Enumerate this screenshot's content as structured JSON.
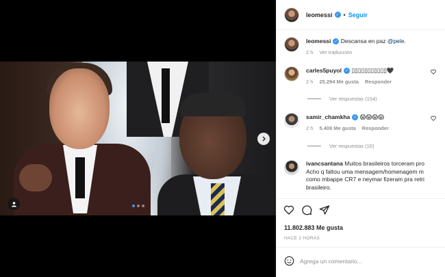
{
  "header": {
    "username": "leomessi",
    "separator": "•",
    "follow_label": "Seguir"
  },
  "caption": {
    "username": "leomessi",
    "text": "Descansa en paz ",
    "mention": "@pele",
    "text_after": ".",
    "time": "2 h",
    "translation_label": "Ver traducción"
  },
  "comments": [
    {
      "username": "carles5puyol",
      "text": "▯▯▯▯▯▯▯▯▯▯▯🖤",
      "time": "2 h",
      "likes": "25.294 Me gusta",
      "reply_label": "Responder",
      "replies_label": "Ver respuestas (154)"
    },
    {
      "username": "samir_chamkha",
      "text": "😱😱😱😱",
      "time": "2 h",
      "likes": "5.409 Me gusta",
      "reply_label": "Responder",
      "replies_label": "Ver respuestas (16)"
    },
    {
      "username": "ivancsantana",
      "line1": "Muitos brasileiros torceram pro",
      "line2": "Acho q faltou uma mensagem/homenagem m",
      "line3": "como mbappe CR7 e neymar fizeram pra retri",
      "line4": "brasileiro."
    }
  ],
  "post": {
    "likes_count": "11.802.883 Me gusta",
    "timestamp": "HACE 2 HORAS",
    "comment_placeholder": "Agrega un comentario..."
  },
  "carousel": {
    "total": 3,
    "active": 0
  },
  "icons": {
    "like": "heart-icon",
    "comment": "comment-icon",
    "share": "send-icon",
    "emoji": "emoji-icon",
    "next": "chevron-right-icon",
    "tagged": "user-tag-icon"
  },
  "colors": {
    "accent": "#0095f6",
    "verified": "#3897f0",
    "muted": "#8e8e8e",
    "text": "#262626"
  }
}
